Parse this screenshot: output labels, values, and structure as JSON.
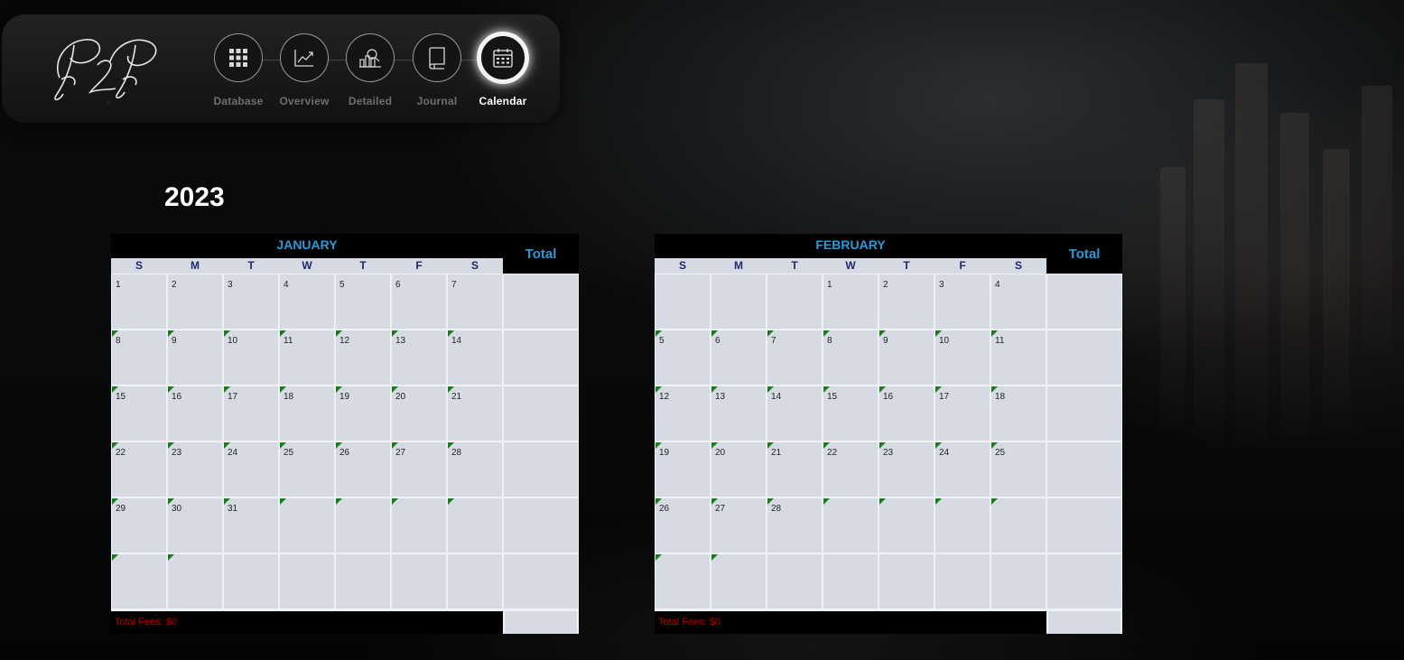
{
  "logo": {
    "text": "P2P"
  },
  "nav": {
    "items": [
      {
        "label": "Database",
        "icon": "grid-icon",
        "active": false
      },
      {
        "label": "Overview",
        "icon": "line-chart-icon",
        "active": false
      },
      {
        "label": "Detailed",
        "icon": "bar-chart-magnifier-icon",
        "active": false
      },
      {
        "label": "Journal",
        "icon": "book-icon",
        "active": false
      },
      {
        "label": "Calendar",
        "icon": "calendar-icon",
        "active": true
      }
    ]
  },
  "year": "2023",
  "colors": {
    "accent": "#2b9bd8",
    "dow": "#1f2a6b",
    "cell": "#d6dbe3",
    "flag": "#1e7a1e",
    "fees": "#c00000"
  },
  "calendars": [
    {
      "month": "JANUARY",
      "total_label": "Total",
      "days_of_week": [
        "S",
        "M",
        "T",
        "W",
        "T",
        "F",
        "S"
      ],
      "weeks": [
        [
          "1",
          "2",
          "3",
          "4",
          "5",
          "6",
          "7"
        ],
        [
          "8",
          "9",
          "10",
          "11",
          "12",
          "13",
          "14"
        ],
        [
          "15",
          "16",
          "17",
          "18",
          "19",
          "20",
          "21"
        ],
        [
          "22",
          "23",
          "24",
          "25",
          "26",
          "27",
          "28"
        ],
        [
          "29",
          "30",
          "31",
          "",
          "",
          "",
          ""
        ],
        [
          "",
          "",
          "",
          "",
          "",
          "",
          ""
        ]
      ],
      "fees": "Total Fees: $0"
    },
    {
      "month": "FEBRUARY",
      "total_label": "Total",
      "days_of_week": [
        "S",
        "M",
        "T",
        "W",
        "T",
        "F",
        "S"
      ],
      "weeks": [
        [
          "",
          "",
          "",
          "1",
          "2",
          "3",
          "4"
        ],
        [
          "5",
          "6",
          "7",
          "8",
          "9",
          "10",
          "11"
        ],
        [
          "12",
          "13",
          "14",
          "15",
          "16",
          "17",
          "18"
        ],
        [
          "19",
          "20",
          "21",
          "22",
          "23",
          "24",
          "25"
        ],
        [
          "26",
          "27",
          "28",
          "",
          "",
          "",
          ""
        ],
        [
          "",
          "",
          "",
          "",
          "",
          "",
          ""
        ]
      ],
      "fees": "Total Fees: $0"
    }
  ]
}
